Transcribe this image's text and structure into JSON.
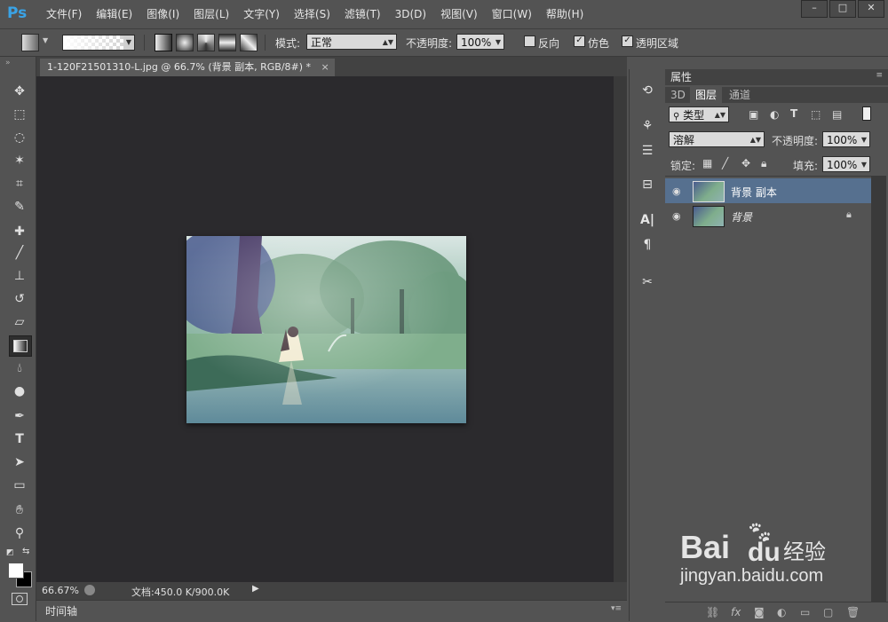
{
  "app": {
    "logo": "Ps"
  },
  "menu": [
    "文件(F)",
    "编辑(E)",
    "图像(I)",
    "图层(L)",
    "文字(Y)",
    "选择(S)",
    "滤镜(T)",
    "3D(D)",
    "视图(V)",
    "窗口(W)",
    "帮助(H)"
  ],
  "window_controls": {
    "minimize": "–",
    "maximize": "□",
    "close": "✕"
  },
  "options": {
    "mode_label": "模式:",
    "mode_value": "正常",
    "opacity_label": "不透明度:",
    "opacity_value": "100%",
    "reverse_label": "反向",
    "reverse_checked": false,
    "dither_label": "仿色",
    "dither_checked": true,
    "transparency_label": "透明区域",
    "transparency_checked": true
  },
  "document": {
    "tab_title": "1-120F21501310-L.jpg @ 66.7% (背景 副本, RGB/8#) *",
    "tab_close": "×",
    "zoom": "66.67%",
    "doc_info": "文档:450.0 K/900.0K"
  },
  "timeline": {
    "label": "时间轴"
  },
  "panel": {
    "properties_tab": "属性",
    "tabs": [
      "3D",
      "图层",
      "通道"
    ],
    "active_tab": "图层",
    "filter_kind": "类型",
    "blend_mode": "溶解",
    "opacity_label": "不透明度:",
    "opacity_value": "100%",
    "lock_label": "锁定:",
    "fill_label": "填充:",
    "fill_value": "100%",
    "layers": [
      {
        "name": "背景 副本",
        "selected": true,
        "locked": false
      },
      {
        "name": "背景",
        "selected": false,
        "locked": true
      }
    ]
  },
  "watermark": {
    "brand": "Bai",
    "brand_suffix": "du",
    "text": "经验",
    "url": "jingyan.baidu.com"
  },
  "colors": {
    "ps_blue": "#3aa3e6",
    "selected_layer": "#56708f",
    "canvas_bg": "#2b2a2d",
    "chrome": "#535353"
  }
}
